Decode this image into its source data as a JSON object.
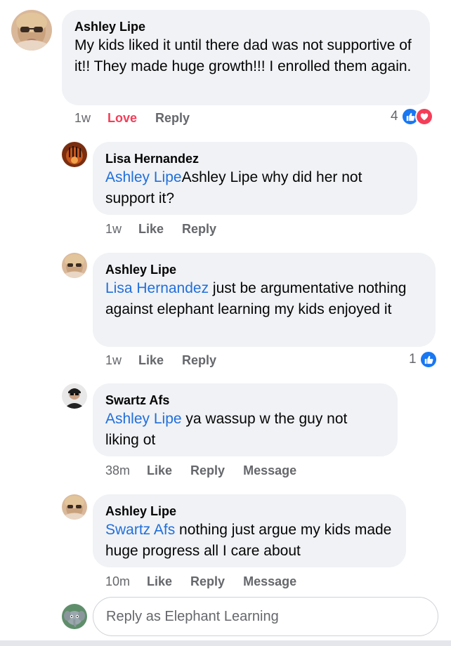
{
  "comments": [
    {
      "author": "Ashley Lipe",
      "mention": "",
      "text": "My kids liked it until there dad was not supportive of  it!! They made huge growth!!! I enrolled them again.",
      "time": "1w",
      "like_label": "Love",
      "reply_label": "Reply",
      "reaction_count": "4",
      "reactions": [
        "like-icon",
        "heart-icon"
      ]
    },
    {
      "author": "Lisa Hernandez",
      "mention": "Ashley Lipe",
      "text": "Ashley Lipe why did her not support it?",
      "time": "1w",
      "like_label": "Like",
      "reply_label": "Reply"
    },
    {
      "author": "Ashley Lipe",
      "mention": "Lisa Hernandez",
      "text": " just be argumentative nothing against elephant learning my kids enjoyed it",
      "time": "1w",
      "like_label": "Like",
      "reply_label": "Reply",
      "reaction_count": "1",
      "reactions": [
        "like-icon"
      ]
    },
    {
      "author": "Swartz Afs",
      "mention": "Ashley Lipe",
      "text": " ya wassup w the guy not liking ot",
      "time": "38m",
      "like_label": "Like",
      "reply_label": "Reply",
      "message_label": "Message"
    },
    {
      "author": "Ashley Lipe",
      "mention": "Swartz Afs",
      "text": " nothing just argue my kids made huge progress all I care about",
      "time": "10m",
      "like_label": "Like",
      "reply_label": "Reply",
      "message_label": "Message"
    }
  ],
  "reply_box": {
    "placeholder": "Reply as Elephant Learning"
  },
  "colors": {
    "mention": "#216fdb",
    "love": "#f33e58",
    "like_blue": "#1877f2",
    "bubble": "#f0f2f5",
    "meta": "#65676b"
  }
}
